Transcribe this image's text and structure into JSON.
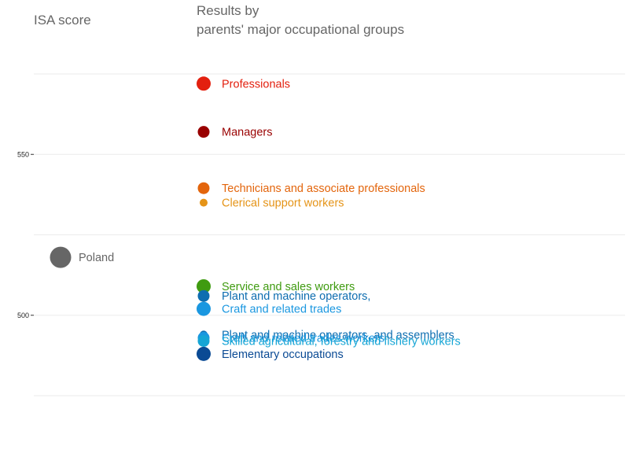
{
  "chart_data": {
    "type": "scatter",
    "ylabel": "ISA score",
    "title_lines": [
      "Results by",
      "parents' major occupational groups"
    ],
    "ylim": [
      475,
      575
    ],
    "yticks": [
      500,
      550
    ],
    "gridlines": [
      475,
      500,
      525,
      550,
      575
    ],
    "country": {
      "name": "Poland",
      "value": 518,
      "color": "#666666"
    },
    "groups": [
      {
        "name": "Professionals",
        "value": 572,
        "color": "#e3200f",
        "size": "large"
      },
      {
        "name": "Managers",
        "value": 557,
        "color": "#990000",
        "size": "medium"
      },
      {
        "name": "Technicians and associate professionals",
        "value": 539.5,
        "color": "#e3650c",
        "size": "medium"
      },
      {
        "name": "Clerical support workers",
        "value": 535,
        "color": "#e59418",
        "size": "small"
      },
      {
        "name": "Service and sales workers",
        "value": 509,
        "color": "#3f9b10",
        "size": "large"
      },
      {
        "name": "Plant and machine operators,",
        "value": 506,
        "color": "#0d6db0",
        "size": "medium"
      },
      {
        "name": "Craft and related trades",
        "value": 502,
        "color": "#1a97e0",
        "size": "large"
      },
      {
        "name": "Plant and machine operators, and assemblers",
        "value": 494,
        "color": "#0d6db0",
        "size": "small"
      },
      {
        "name": "Craft and related trades workers",
        "value": 493,
        "color": "#1a97e0",
        "size": "medium"
      },
      {
        "name": "Skilled agricultural, forestry and fishery workers",
        "value": 492,
        "color": "#15a5d5",
        "size": "medium"
      },
      {
        "name": "Elementary occupations",
        "value": 488,
        "color": "#0a4a94",
        "size": "large"
      }
    ]
  }
}
